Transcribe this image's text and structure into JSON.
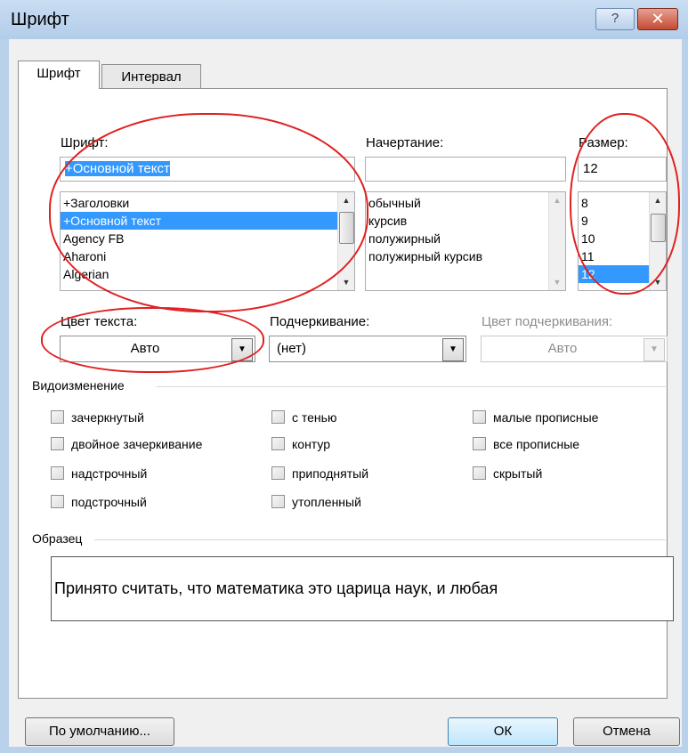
{
  "window": {
    "title": "Шрифт",
    "help_label": "?",
    "close_label": "✕"
  },
  "tabs": [
    {
      "label": "Шрифт"
    },
    {
      "label": "Интервал"
    }
  ],
  "font": {
    "label": "Шрифт:",
    "value": "+Основной текст",
    "items": [
      "+Заголовки",
      "+Основной текст",
      "Agency FB",
      "Aharoni",
      "Algerian"
    ],
    "selected_index": 1
  },
  "style": {
    "label": "Начертание:",
    "value": "",
    "items": [
      "обычный",
      "курсив",
      "полужирный",
      "полужирный курсив"
    ]
  },
  "size": {
    "label": "Размер:",
    "value": "12",
    "items": [
      "8",
      "9",
      "10",
      "11",
      "12"
    ],
    "selected_index": 4
  },
  "text_color": {
    "label": "Цвет текста:",
    "value": "Авто"
  },
  "underline": {
    "label": "Подчеркивание:",
    "value": "(нет)"
  },
  "underline_color": {
    "label": "Цвет подчеркивания:",
    "value": "Авто"
  },
  "effects": {
    "label": "Видоизменение",
    "col1": [
      "зачеркнутый",
      "двойное зачеркивание",
      "надстрочный",
      "подстрочный"
    ],
    "col2": [
      "с тенью",
      "контур",
      "приподнятый",
      "утопленный"
    ],
    "col3": [
      "малые прописные",
      "все прописные",
      "скрытый"
    ]
  },
  "preview": {
    "label": "Образец",
    "text": "Принято считать, что математика  это царица наук, и любая"
  },
  "buttons": {
    "default": "По умолчанию...",
    "ok": "ОК",
    "cancel": "Отмена"
  },
  "colors": {
    "annotation": "#e02020",
    "selection": "#3399ff"
  }
}
